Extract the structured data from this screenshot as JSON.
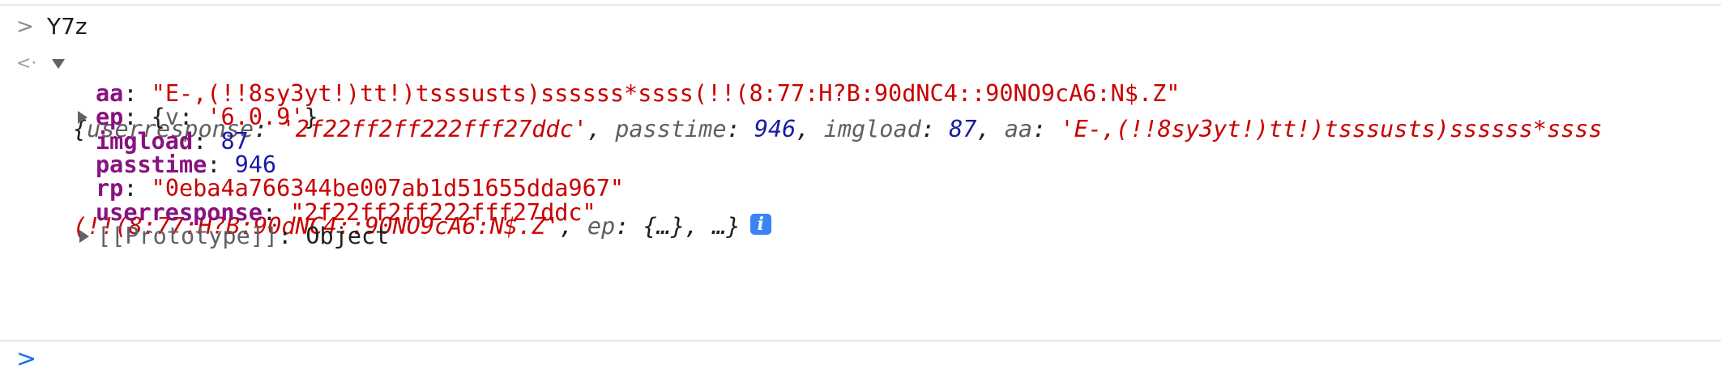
{
  "input": {
    "chevron": ">",
    "expression": "Y7z"
  },
  "result": {
    "return_icon": "<·",
    "preview_line1": [
      {
        "t": "{",
        "c": "pk"
      },
      {
        "t": "userresponse",
        "c": "k"
      },
      {
        "t": ": ",
        "c": "pk"
      },
      {
        "t": "'2f22ff2ff222fff27ddc'",
        "c": "sv"
      },
      {
        "t": ", ",
        "c": "pk"
      },
      {
        "t": "passtime",
        "c": "k"
      },
      {
        "t": ": ",
        "c": "pk"
      },
      {
        "t": "946",
        "c": "nv"
      },
      {
        "t": ", ",
        "c": "pk"
      },
      {
        "t": "imgload",
        "c": "k"
      },
      {
        "t": ": ",
        "c": "pk"
      },
      {
        "t": "87",
        "c": "nv"
      },
      {
        "t": ", ",
        "c": "pk"
      },
      {
        "t": "aa",
        "c": "k"
      },
      {
        "t": ": ",
        "c": "pk"
      },
      {
        "t": "'E-,(!!8sy3yt!)tt!)tsssusts)ssssss*ssss",
        "c": "sv"
      }
    ],
    "preview_line2": [
      {
        "t": "(!!(8:77:H?B:90dNC4::90NO9cA6:N$.Z'",
        "c": "sv"
      },
      {
        "t": ", ",
        "c": "pk"
      },
      {
        "t": "ep",
        "c": "k"
      },
      {
        "t": ": {…}, …}",
        "c": "pk"
      }
    ],
    "info_badge": "i",
    "properties": [
      {
        "key": "aa",
        "sep": ": ",
        "value": "\"E-,(!!8sy3yt!)tt!)tsssusts)ssssss*ssss(!!(8:77:H?B:90dNC4::90NO9cA6:N$.Z\"",
        "vtype": "string",
        "expandable": false
      },
      {
        "key": "ep",
        "sep": ": ",
        "value_parts": [
          {
            "t": "{",
            "c": "plain"
          },
          {
            "t": "v",
            "c": "k"
          },
          {
            "t": ": ",
            "c": "plain"
          },
          {
            "t": "'6.0.9'",
            "c": "sv"
          },
          {
            "t": "}",
            "c": "plain"
          }
        ],
        "expandable": true
      },
      {
        "key": "imgload",
        "sep": ": ",
        "value": "87",
        "vtype": "number",
        "expandable": false
      },
      {
        "key": "passtime",
        "sep": ": ",
        "value": "946",
        "vtype": "number",
        "expandable": false
      },
      {
        "key": "rp",
        "sep": ": ",
        "value": "\"0eba4a766344be007ab1d51655dda967\"",
        "vtype": "string",
        "expandable": false
      },
      {
        "key": "userresponse",
        "sep": ": ",
        "value": "\"2f22ff2ff222fff27ddc\"",
        "vtype": "string",
        "expandable": false
      },
      {
        "key": "[[Prototype]]",
        "sep": ": ",
        "value": "Object",
        "vtype": "plain",
        "expandable": true,
        "proto": true
      }
    ]
  },
  "prompt": {
    "chevron": ">"
  },
  "colors": {
    "string": "#c80000",
    "number": "#1a1aa6",
    "property_key": "#881280",
    "prompt": "#1a73e8",
    "info_badge": "#3b82f6"
  }
}
